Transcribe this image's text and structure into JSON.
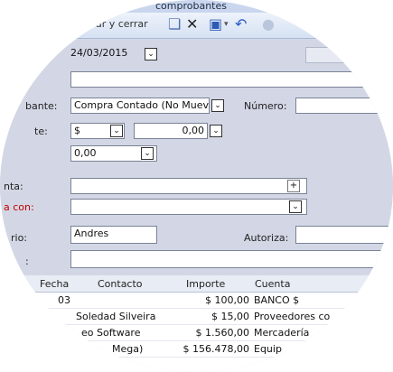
{
  "window": {
    "title": "comprobantes"
  },
  "toolbar": {
    "save_close": "ubar y cerrar"
  },
  "form": {
    "date": "24/03/2015",
    "comprobante_label": "bante:",
    "comprobante_value": "Compra Contado (No Mueve",
    "numero_label": "Número:",
    "moneda_label": "te:",
    "moneda_value": "$",
    "importe_value": "0,00",
    "otro_value": "0,00",
    "cuenta_label": "nta:",
    "paga_label": "a con:",
    "usuario_label": "rio:",
    "usuario_value": "Andres",
    "autoriza_label": "Autoriza:",
    "obs_label": ":"
  },
  "grid": {
    "headers": [
      "Fecha",
      "Contacto",
      "Importe",
      "Cuenta"
    ],
    "rows": [
      {
        "fecha": "03",
        "contacto": "",
        "importe": "$ 100,00",
        "cuenta": "BANCO $"
      },
      {
        "fecha": "",
        "contacto": "Soledad Silveira",
        "importe": "$ 15,00",
        "cuenta": "Proveedores co"
      },
      {
        "fecha": "",
        "contacto": "eo Software",
        "importe": "$ 1.560,00",
        "cuenta": "Mercadería"
      },
      {
        "fecha": "",
        "contacto": "Mega)",
        "importe": "$ 156.478,00",
        "cuenta": "Equip"
      }
    ]
  }
}
